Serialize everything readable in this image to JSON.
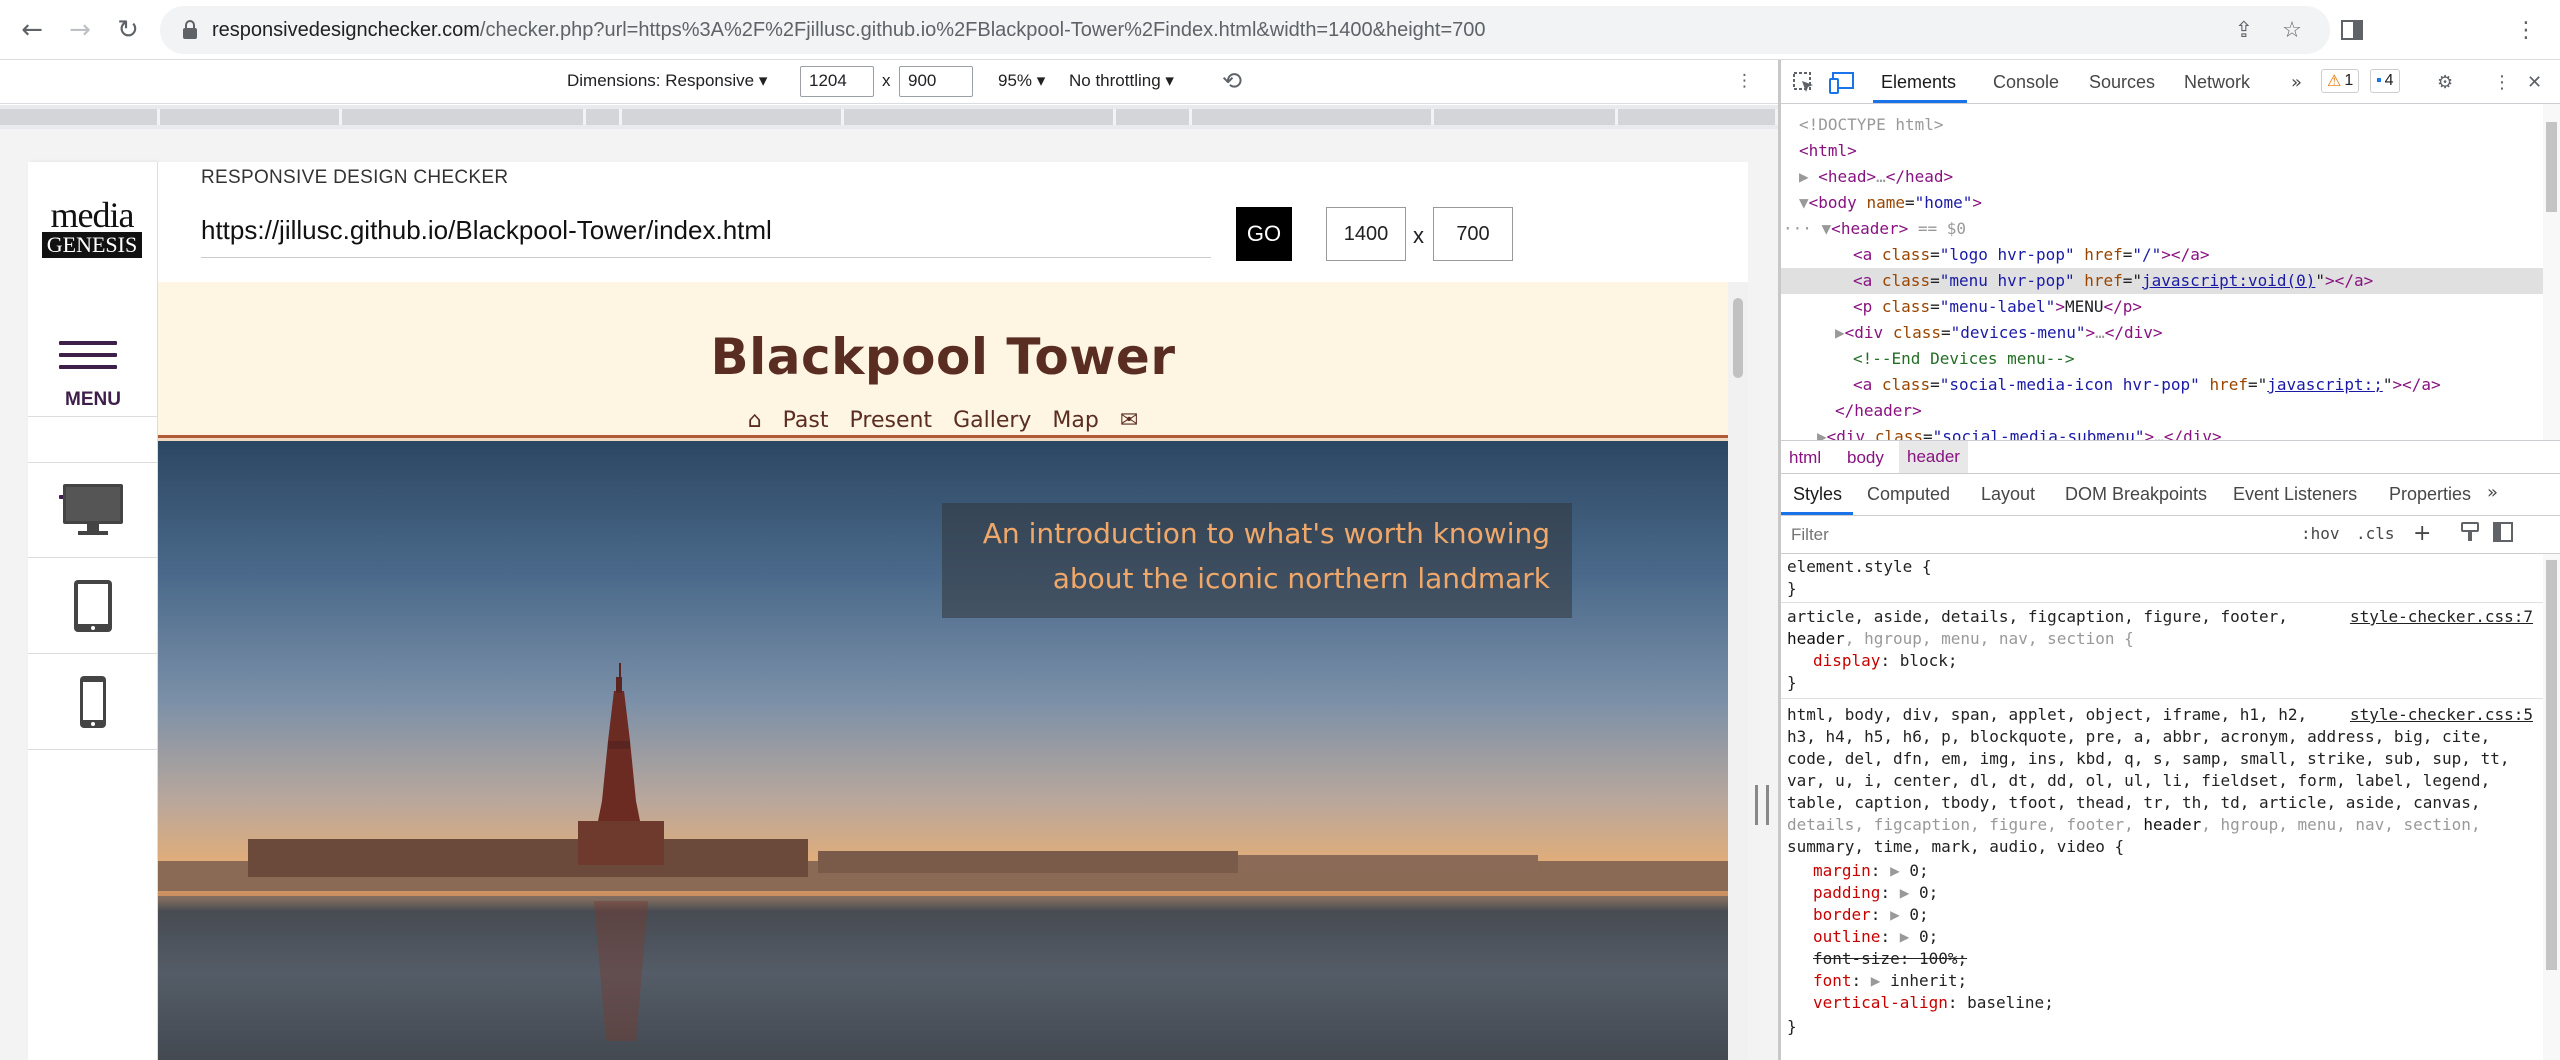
{
  "browser": {
    "url_host": "responsivedesignchecker.com",
    "url_path": "/checker.php?url=https%3A%2F%2Fjillusc.github.io%2FBlackpool-Tower%2Findex.html&width=1400&height=700"
  },
  "emulation": {
    "dimensions_label": "Dimensions: Responsive",
    "width": "1204",
    "times": "x",
    "height": "900",
    "zoom": "95%",
    "throttling": "No throttling"
  },
  "checker": {
    "title": "RESPONSIVE DESIGN CHECKER",
    "url_value": "https://jillusc.github.io/Blackpool-Tower/index.html",
    "go_label": "GO",
    "width": "1400",
    "times": "x",
    "height": "700",
    "menu_label": "MENU",
    "logo_top": "media",
    "logo_bottom": "GENESIS"
  },
  "site": {
    "title": "Blackpool Tower",
    "nav": [
      "Past",
      "Present",
      "Gallery",
      "Map"
    ],
    "caption_line1": "An introduction to what's worth knowing",
    "caption_line2": "about the iconic northern landmark"
  },
  "devtools": {
    "tabs": [
      "Elements",
      "Console",
      "Sources",
      "Network"
    ],
    "warnings": "1",
    "messages": "4",
    "dom": {
      "doctype": "<!DOCTYPE html>",
      "html_open": "<html>",
      "head": "head",
      "body_tag": "body",
      "body_attr": "name",
      "body_val": "\"home\"",
      "header_tag": "header",
      "header_marker": "== $0",
      "a1_class": "\"logo hvr-pop\"",
      "a1_href": "\"/\"",
      "a2_class": "\"menu hvr-pop\"",
      "a2_href": "javascript:void(0)",
      "p_class": "\"menu-label\"",
      "p_text": "MENU",
      "div_class": "\"devices-menu\"",
      "comment": "<!--End Devices menu-->",
      "a3_class": "\"social-media-icon hvr-pop\"",
      "a3_href": "javascript:;",
      "header_close": "</header>",
      "submenu_class": "\"social-media-submenu\""
    },
    "breadcrumbs": [
      "html",
      "body",
      "header"
    ],
    "style_tabs": [
      "Styles",
      "Computed",
      "Layout",
      "DOM Breakpoints",
      "Event Listeners",
      "Properties"
    ],
    "filter_placeholder": "Filter",
    "hov": ":hov",
    "cls": ".cls",
    "styles": {
      "element_style": "element.style {",
      "close_brace": "}",
      "rule1_sel1": "article, aside, details, figcaption, figure, footer,",
      "rule1_sel2_a": "header",
      "rule1_sel2_b": ", hgroup, menu, nav, section {",
      "rule1_src": "style-checker.css:7",
      "rule1_prop": "display",
      "rule1_val": "block;",
      "rule2_sel1": "html, body, div, span, applet, object, iframe, h1, h2,",
      "rule2_sel2": "h3, h4, h5, h6, p, blockquote, pre, a, abbr, acronym, address, big, cite,",
      "rule2_sel3": "code, del, dfn, em, img, ins, kbd, q, s, samp, small, strike, sub, sup, tt,",
      "rule2_sel4": "var, u, i, center, dl, dt, dd, ol, ul, li, fieldset, form, label, legend,",
      "rule2_sel5": "table, caption, tbody, tfoot, thead, tr, th, td, article, aside, canvas,",
      "rule2_sel6_a": "details, figcaption, figure, footer, ",
      "rule2_sel6_b": "header",
      "rule2_sel6_c": ", hgroup, menu, nav, section,",
      "rule2_sel7": "summary, time, mark, audio, video {",
      "rule2_src": "style-checker.css:5",
      "margin": "margin",
      "padding": "padding",
      "border": "border",
      "outline": "outline",
      "zero": "0;",
      "font_size": "font-size: 100%;",
      "font": "font",
      "font_val": "inherit;",
      "valign": "vertical-align",
      "valign_val": "baseline;"
    }
  }
}
